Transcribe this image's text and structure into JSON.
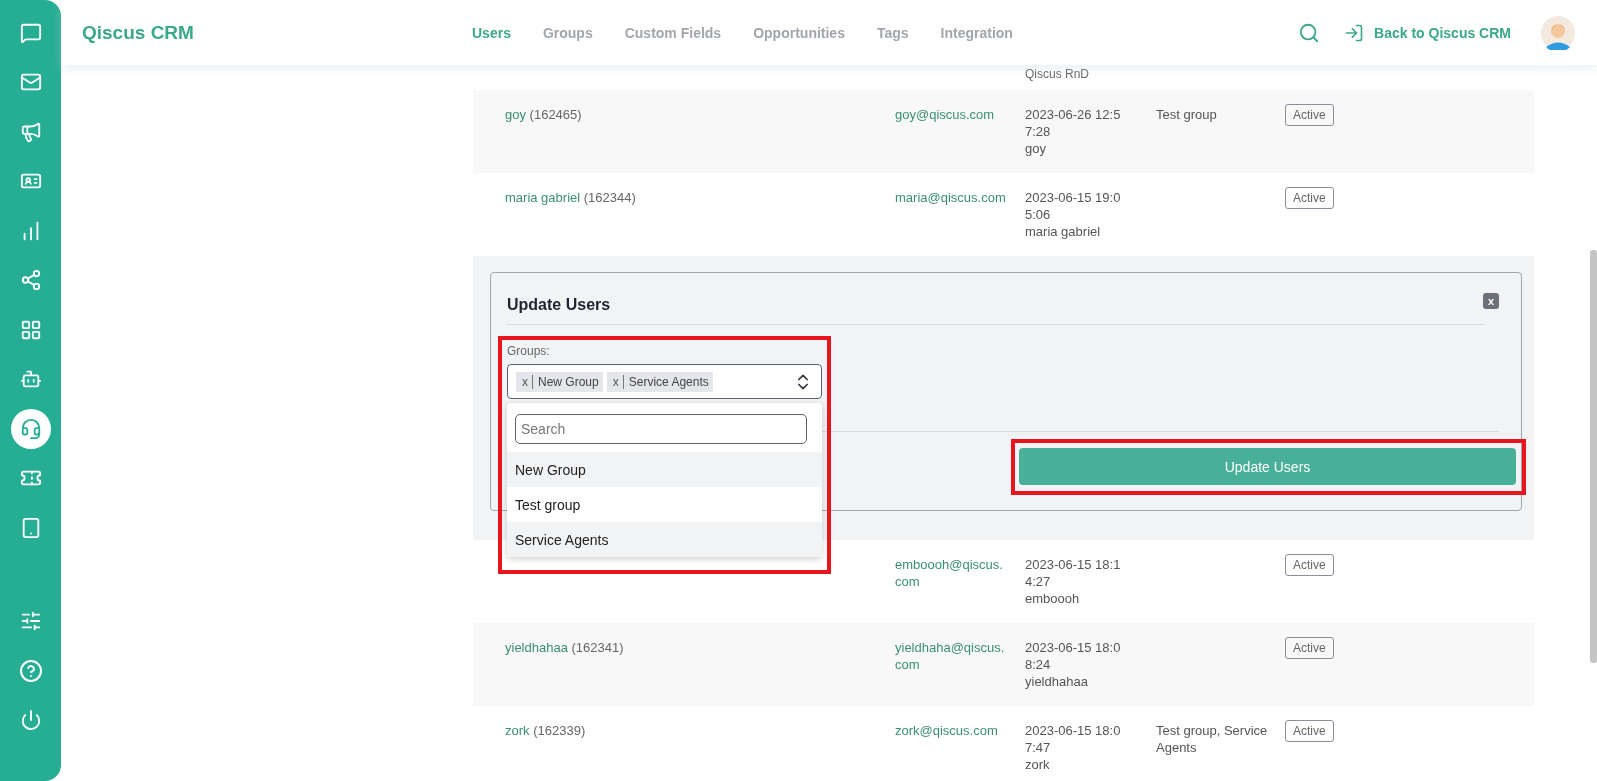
{
  "sidebar": {
    "items": [
      {
        "kind": "chat",
        "selected": false
      },
      {
        "kind": "mail",
        "selected": false
      },
      {
        "kind": "megaphone",
        "selected": false
      },
      {
        "kind": "contact",
        "selected": false
      },
      {
        "kind": "chart",
        "selected": false
      },
      {
        "kind": "share",
        "selected": false
      },
      {
        "kind": "apps",
        "selected": false
      },
      {
        "kind": "bot",
        "selected": false
      },
      {
        "kind": "agent",
        "selected": true
      },
      {
        "kind": "ticket",
        "selected": false
      },
      {
        "kind": "device",
        "selected": false
      }
    ],
    "bottom_items": [
      {
        "kind": "sliders",
        "selected": false
      },
      {
        "kind": "help",
        "selected": false
      },
      {
        "kind": "power",
        "selected": false
      }
    ]
  },
  "header": {
    "logo": "Qiscus CRM",
    "tabs": [
      {
        "label": "Users",
        "selected": true
      },
      {
        "label": "Groups",
        "selected": false
      },
      {
        "label": "Custom Fields",
        "selected": false
      },
      {
        "label": "Opportunities",
        "selected": false
      },
      {
        "label": "Tags",
        "selected": false
      },
      {
        "label": "Integration",
        "selected": false
      }
    ],
    "back_link": "Back to Qiscus CRM"
  },
  "table": {
    "top_fragment": "Qiscus RnD",
    "rows_above": [
      {
        "name": "goy",
        "id": "(162465)",
        "email": "goy@qiscus.com",
        "date": "2023-06-26 12:57:28",
        "created_by": "goy",
        "groups": "Test group",
        "status": "Active"
      },
      {
        "name": "maria gabriel",
        "id": "(162344)",
        "email": "maria@qiscus.com",
        "date": "2023-06-15 19:05:06",
        "created_by": "maria gabriel",
        "status": "Active"
      }
    ],
    "rows_below": [
      {
        "email": "emboooh@qiscus.com",
        "date": "2023-06-15 18:14:27",
        "created_by": "emboooh",
        "status": "Active"
      },
      {
        "name": "yieldhahaa",
        "id": "(162341)",
        "email": "yieldhaha@qiscus.com",
        "date": "2023-06-15 18:08:24",
        "created_by": "yieldhahaa",
        "status": "Active"
      },
      {
        "name": "zork",
        "id": "(162339)",
        "email": "zork@qiscus.com",
        "date": "2023-06-15 18:07:47",
        "created_by": "zork",
        "groups": "Test group, Service Agents",
        "status": "Active"
      }
    ]
  },
  "modal": {
    "title": "Update Users",
    "close": "x",
    "groups_label": "Groups:",
    "chips": [
      {
        "label": "New Group",
        "remove": "x"
      },
      {
        "label": "Service Agents",
        "remove": "x"
      }
    ],
    "search_placeholder": "Search",
    "options": [
      {
        "label": "New Group",
        "selected": true
      },
      {
        "label": "Test group",
        "selected": false
      },
      {
        "label": "Service Agents",
        "selected": true
      }
    ],
    "submit": "Update Users"
  }
}
